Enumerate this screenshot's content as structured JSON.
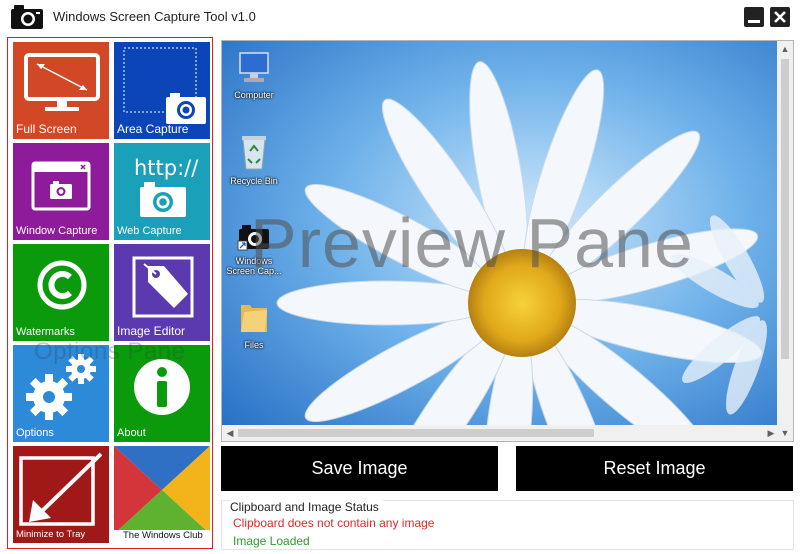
{
  "window": {
    "title": "Windows Screen Capture Tool v1.0",
    "icons": {
      "app": "camera-icon",
      "minimize": "minimize-icon",
      "close": "close-icon"
    }
  },
  "options_pane": {
    "watermark": "Options Pane",
    "border_color": "#e02020",
    "tiles": [
      {
        "label": "Full Screen",
        "color": "#d24726",
        "icon": "monitor-icon"
      },
      {
        "label": "Area Capture",
        "color": "#0b45b8",
        "icon": "area-camera-icon"
      },
      {
        "label": "Window Capture",
        "color": "#8e1c9a",
        "icon": "window-camera-icon"
      },
      {
        "label": "Web Capture",
        "color": "#1aa0b8",
        "icon": "web-camera-icon"
      },
      {
        "label": "Watermarks",
        "color": "#0b9a0b",
        "icon": "copyright-icon"
      },
      {
        "label": "Image Editor",
        "color": "#5b3ab0",
        "icon": "tag-icon"
      },
      {
        "label": "Options",
        "color": "#2d8ad8",
        "icon": "gears-icon"
      },
      {
        "label": "About",
        "color": "#0b9a0b",
        "icon": "info-icon"
      },
      {
        "label": "Minimize to Tray",
        "color": "#a01818",
        "icon": "minimize-arrow-icon"
      },
      {
        "label": "The Windows Club",
        "color": "#ffffff",
        "icon": "windows-club-logo"
      }
    ]
  },
  "preview": {
    "watermark": "Preview Pane",
    "desktop_icons": [
      {
        "label": "Computer",
        "icon": "computer-icon"
      },
      {
        "label": "Recycle Bin",
        "icon": "recycle-bin-icon"
      },
      {
        "label": "Windows Screen Cap...",
        "icon": "camera-shortcut-icon"
      },
      {
        "label": "Files",
        "icon": "folder-icon"
      }
    ]
  },
  "buttons": {
    "save": "Save Image",
    "reset": "Reset Image"
  },
  "status": {
    "title": "Clipboard and Image Status",
    "clipboard": "Clipboard does not contain any image",
    "clipboard_color": "#e02828",
    "image": "Image Loaded",
    "image_color": "#2e9a2e"
  }
}
